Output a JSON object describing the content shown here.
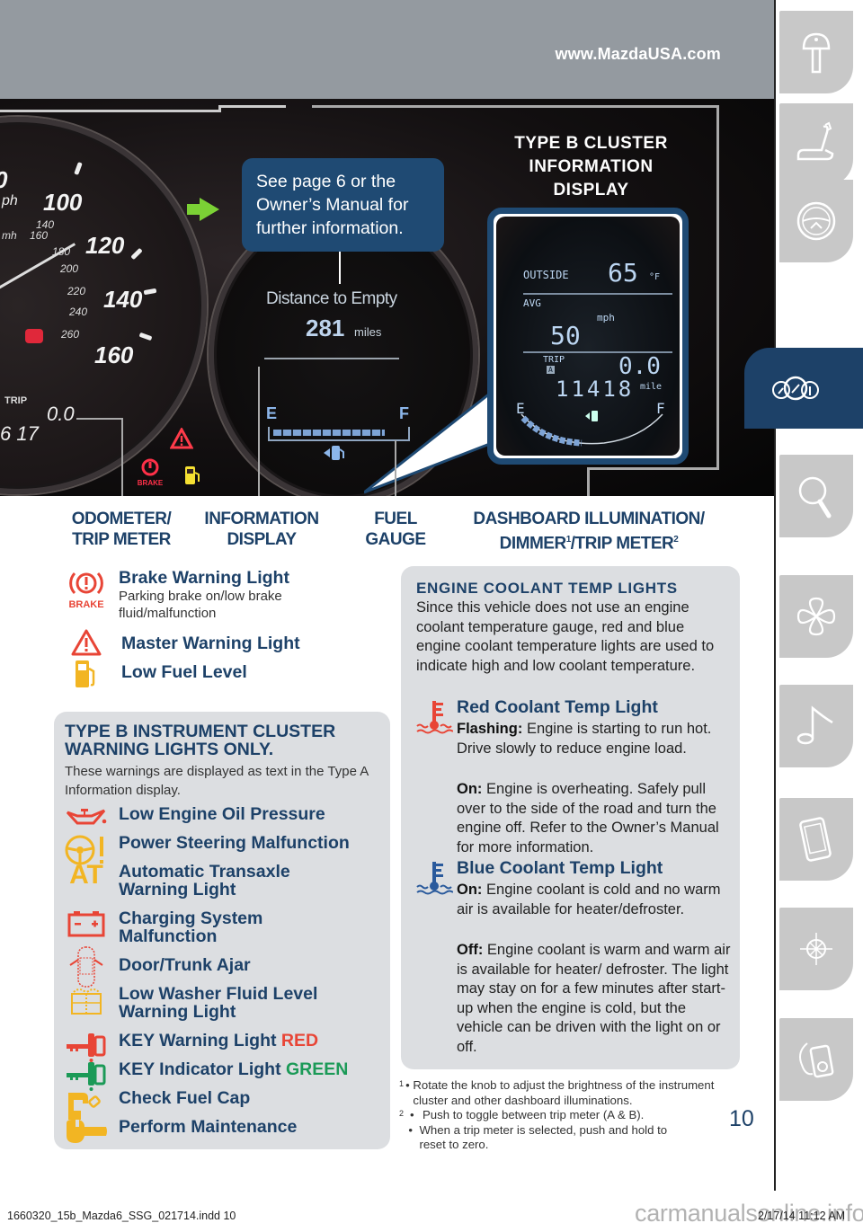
{
  "header": {
    "url": "www.MazdaUSA.com"
  },
  "dashboard_photo": {
    "speedometer": {
      "mph_labels": [
        "100",
        "120",
        "140",
        "160"
      ],
      "kmh_labels": [
        "140",
        "160",
        "180",
        "200",
        "220",
        "240",
        "260"
      ],
      "partial_mph_label": "0",
      "unit_mph": "ph",
      "unit_kmh": "mh"
    },
    "odometer_display": {
      "trip_label": "TRIP",
      "trip_value": "0.0",
      "odometer_partial": "6 17"
    },
    "info_display": {
      "label": "Distance to Empty",
      "value": "281",
      "unit": "miles",
      "fuel_empty": "E",
      "fuel_full": "F",
      "fuel_level_fraction": 0.85
    },
    "callout_text": "See page 6 or the Owner’s Manual for further information.",
    "type_b_title": "TYPE B CLUSTER INFORMATION DISPLAY",
    "type_b_display": {
      "outside_label": "OUTSIDE",
      "outside_value": "65",
      "outside_unit": "°F",
      "avg_label": "AVG",
      "avg_unit": "mph",
      "avg_value": "50",
      "trip_label": "TRIP",
      "trip_sub": "A",
      "trip_value": "0.0",
      "odo_value": "11418",
      "odo_unit": "mile",
      "fuel_empty": "E",
      "fuel_full": "F"
    }
  },
  "captions": [
    {
      "line1": "ODOMETER/",
      "line2": "TRIP METER"
    },
    {
      "line1": "INFORMATION",
      "line2": "DISPLAY"
    },
    {
      "line1": "FUEL",
      "line2": "GAUGE"
    },
    {
      "line1": "DASHBOARD ILLUMINATION/",
      "line2a": "DIMMER",
      "sup1": "1",
      "line2b": "/TRIP METER",
      "sup2": "2"
    }
  ],
  "warning_lights": [
    {
      "icon": "brake-warning-icon",
      "icon_text": "BRAKE",
      "title": "Brake Warning Light",
      "description": "Parking brake on/low brake fluid/malfunction"
    },
    {
      "icon": "master-warning-icon",
      "title": "Master Warning Light"
    },
    {
      "icon": "low-fuel-icon",
      "title": "Low Fuel Level"
    }
  ],
  "type_b_box": {
    "heading": "TYPE B INSTRUMENT CLUSTER WARNING LIGHTS ONLY.",
    "subtext": "These warnings are displayed as text in the Type A Information display.",
    "items": [
      {
        "icon": "oil-pressure-icon",
        "title": "Low Engine Oil Pressure"
      },
      {
        "icon": "power-steering-icon",
        "title": "Power Steering Malfunction"
      },
      {
        "icon": "automatic-transaxle-icon",
        "icon_text": "AT",
        "title": "Automatic Transaxle Warning Light"
      },
      {
        "icon": "battery-icon",
        "title": "Charging System Malfunction"
      },
      {
        "icon": "door-ajar-icon",
        "title": "Door/Trunk Ajar"
      },
      {
        "icon": "washer-fluid-icon",
        "title": "Low Washer Fluid Level Warning Light"
      },
      {
        "icon": "key-red-icon",
        "title": "KEY Warning Light",
        "accent": "RED",
        "accent_color": "#e84536"
      },
      {
        "icon": "key-green-icon",
        "title": "KEY Indicator Light",
        "accent": "GREEN",
        "accent_color": "#1b9a57"
      },
      {
        "icon": "fuel-cap-icon",
        "title": "Check Fuel Cap"
      },
      {
        "icon": "wrench-icon",
        "title": "Perform Maintenance"
      }
    ]
  },
  "coolant_box": {
    "heading": "ENGINE COOLANT TEMP LIGHTS",
    "intro": "Since this vehicle does not use an engine coolant temperature gauge, red and blue engine coolant temperature lights are used to indicate high and low coolant temperature.",
    "red": {
      "title": "Red Coolant Temp Light",
      "flashing_label": "Flashing:",
      "flashing_text": "Engine is starting to run hot. Drive slowly to reduce engine load.",
      "on_label": "On:",
      "on_text": "Engine is overheating. Safely pull over to the side of the road and turn the engine off. Refer to the Owner’s Manual for more information."
    },
    "blue": {
      "title": "Blue Coolant Temp Light",
      "on_label": "On:",
      "on_text": "Engine coolant is cold and no warm air is available for heater/defroster.",
      "off_label": "Off:",
      "off_text": "Engine coolant is warm and warm air is available for heater/ defroster. The light may stay on for a few minutes after start-up when the engine is cold, but the vehicle can be driven with the light on or off."
    }
  },
  "footnotes": [
    {
      "num": "1",
      "bullets": [
        "Rotate the knob to adjust the brightness of the instrument cluster and other dashboard illuminations."
      ]
    },
    {
      "num": "2",
      "bullets": [
        "Push to toggle between trip meter (A & B).",
        "When a trip meter is selected, push and hold to reset to zero."
      ]
    }
  ],
  "page_number": "10",
  "side_tabs": [
    {
      "icon": "key-icon",
      "active": false
    },
    {
      "icon": "seat-icon",
      "active": false
    },
    {
      "icon": "steering-wheel-icon",
      "active": false
    },
    {
      "icon": "gauges-icon",
      "active": true
    },
    {
      "icon": "magnifier-icon",
      "active": false
    },
    {
      "icon": "fan-icon",
      "active": false
    },
    {
      "icon": "music-note-icon",
      "active": false
    },
    {
      "icon": "smartphone-icon",
      "active": false
    },
    {
      "icon": "compass-icon",
      "active": false
    },
    {
      "icon": "media-player-icon",
      "active": false
    }
  ],
  "colors": {
    "navy": "#1d4168",
    "callout_blue": "#1f4a73",
    "header_gray": "#949aa0",
    "box_gray": "#dcdee1",
    "warning_red": "#e84536",
    "warning_yellow": "#f2b523",
    "indicator_green": "#1b9a57"
  },
  "slug": {
    "file": "1660320_15b_Mazda6_SSG_021714.indd   10",
    "date": "2/17/14   11:12 AM",
    "watermark": "carmanualsonline.info"
  }
}
